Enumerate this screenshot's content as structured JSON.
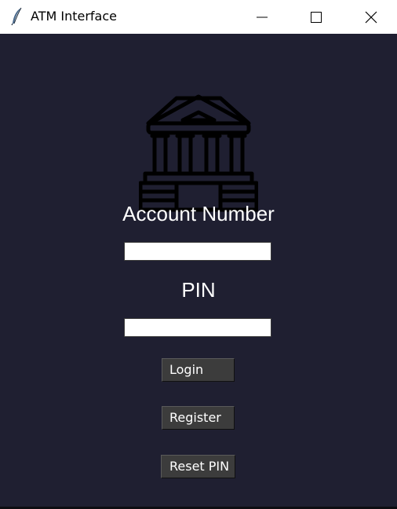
{
  "window": {
    "title": "ATM Interface",
    "app_icon": "feather-icon",
    "controls": {
      "minimize": "minimize-icon",
      "maximize": "maximize-icon",
      "close": "close-icon"
    }
  },
  "logo": "bank-building-icon",
  "form": {
    "account_label": "Account Number",
    "account_value": "",
    "pin_label": "PIN",
    "pin_value": ""
  },
  "buttons": {
    "login": "Login",
    "register": "Register",
    "reset_pin": "Reset PIN"
  },
  "colors": {
    "background": "#1f1f31",
    "button": "#3c3c3c",
    "text": "#ffffff"
  }
}
